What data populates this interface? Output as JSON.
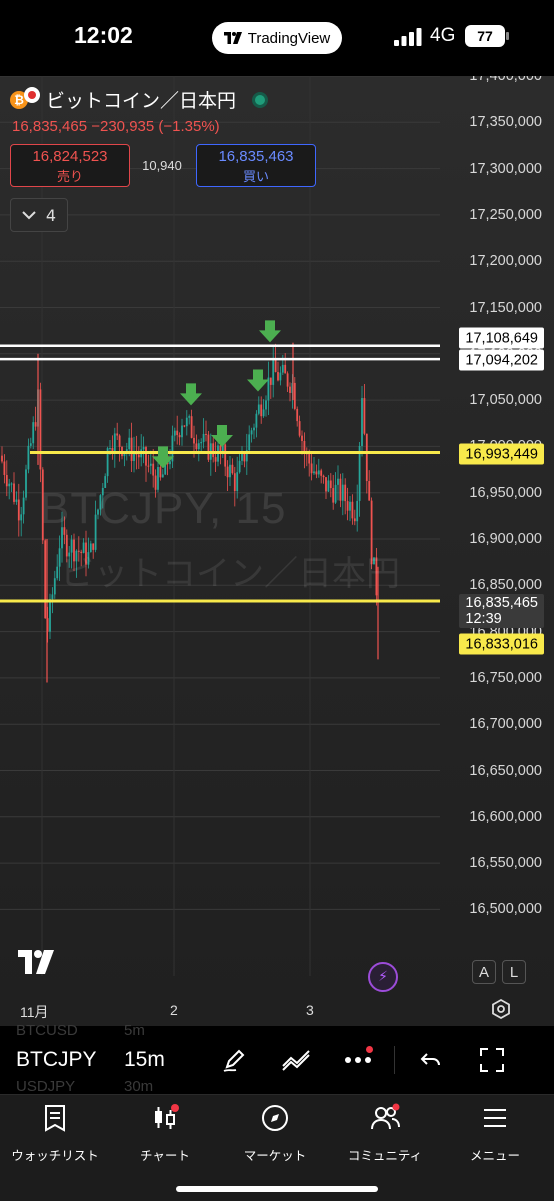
{
  "status_bar": {
    "time": "12:02",
    "app_name": "TradingView",
    "network": "4G",
    "battery": "77"
  },
  "chart": {
    "title": "ビットコイン／日本円",
    "change_line": "16,835,465 −230,935 (−1.35%)",
    "sell": {
      "price": "16,824,523",
      "label": "売り"
    },
    "buy": {
      "price": "16,835,463",
      "label": "買い"
    },
    "spread": "10,940",
    "indicator_count": "4",
    "watermark_symbol": "BTCJPY, 15",
    "watermark_name": "ビットコイン／日本円",
    "y_ticks": [
      "17,400,000",
      "17,350,000",
      "17,300,000",
      "17,250,000",
      "17,200,000",
      "17,150,000",
      "17,100,000",
      "17,050,000",
      "17,000,000",
      "16,950,000",
      "16,900,000",
      "16,850,000",
      "16,800,000",
      "16,750,000",
      "16,700,000",
      "16,650,000",
      "16,600,000",
      "16,550,000",
      "16,500,000"
    ],
    "price_tags": {
      "white_high": "17,108,649",
      "white_low": "17,094,202",
      "yellow_upper": "16,993,449",
      "current": "16,835,465",
      "countdown": "12:39",
      "yellow_lower": "16,833,016"
    },
    "x_labels": [
      "11月",
      "2",
      "3"
    ],
    "scale_buttons": [
      "A",
      "L"
    ],
    "colors": {
      "up": "#26a69a",
      "down": "#ef5350",
      "white_line": "#ffffff",
      "yellow_line": "#f8e94b",
      "arrow": "#4caf50"
    }
  },
  "toolbar": {
    "symbol": "BTCJPY",
    "interval": "15m",
    "ghost_above": {
      "symbol": "BTCUSD",
      "interval": "5m"
    },
    "ghost_below": {
      "symbol": "USDJPY",
      "interval": "30m"
    },
    "icons": [
      "draw-pen-icon",
      "indicators-icon",
      "more-icon",
      "undo-icon",
      "fullscreen-icon"
    ]
  },
  "bottom_nav": [
    {
      "label": "ウォッチリスト",
      "icon": "watchlist-icon"
    },
    {
      "label": "チャート",
      "icon": "chart-icon"
    },
    {
      "label": "マーケット",
      "icon": "compass-icon"
    },
    {
      "label": "コミュニティ",
      "icon": "community-icon"
    },
    {
      "label": "メニュー",
      "icon": "menu-icon"
    }
  ]
}
